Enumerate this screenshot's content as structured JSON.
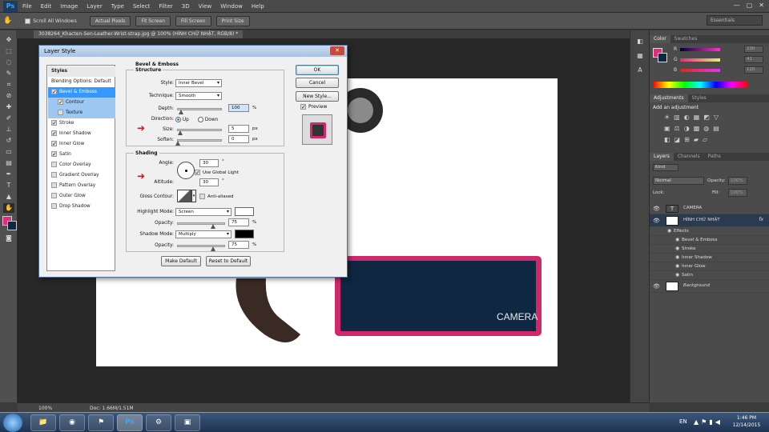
{
  "app": {
    "logo": "Ps",
    "menu": [
      "File",
      "Edit",
      "Image",
      "Layer",
      "Type",
      "Select",
      "Filter",
      "3D",
      "View",
      "Window",
      "Help"
    ],
    "window_controls": [
      "—",
      "▢",
      "✕"
    ]
  },
  "options_bar": {
    "scroll_all_windows": "Scroll All Windows",
    "buttons": [
      "Actual Pixels",
      "Fit Screen",
      "Fill Screen",
      "Print Size"
    ],
    "workspace": "Essentials"
  },
  "document": {
    "tab_title": "3038264_Khacten-Sen-Leather-Wrist-strap.jpg @ 100% (HÌNH CHỮ NHẬT, RGB/8) *",
    "canvas_text": "CAMERA",
    "zoom": "100%",
    "doc_size": "Doc: 1.66M/1.51M"
  },
  "dialog": {
    "title": "Layer Style",
    "close": "✕",
    "styles_header": "Styles",
    "blending_options": "Blending Options: Default",
    "style_items": [
      {
        "label": "Bevel & Emboss",
        "checked": true,
        "state": "selected"
      },
      {
        "label": "Contour",
        "checked": true,
        "state": "sub"
      },
      {
        "label": "Texture",
        "checked": false,
        "state": "sub"
      },
      {
        "label": "Stroke",
        "checked": true,
        "state": ""
      },
      {
        "label": "Inner Shadow",
        "checked": true,
        "state": ""
      },
      {
        "label": "Inner Glow",
        "checked": true,
        "state": ""
      },
      {
        "label": "Satin",
        "checked": true,
        "state": ""
      },
      {
        "label": "Color Overlay",
        "checked": false,
        "state": ""
      },
      {
        "label": "Gradient Overlay",
        "checked": false,
        "state": ""
      },
      {
        "label": "Pattern Overlay",
        "checked": false,
        "state": ""
      },
      {
        "label": "Outer Glow",
        "checked": false,
        "state": ""
      },
      {
        "label": "Drop Shadow",
        "checked": false,
        "state": ""
      }
    ],
    "section_title": "Bevel & Emboss",
    "structure": {
      "title": "Structure",
      "style_label": "Style:",
      "style_value": "Inner Bevel",
      "technique_label": "Technique:",
      "technique_value": "Smooth",
      "depth_label": "Depth:",
      "depth_value": "100",
      "depth_unit": "%",
      "depth_level": 0.08,
      "direction_label": "Direction:",
      "direction_up": "Up",
      "direction_down": "Down",
      "size_label": "Size:",
      "size_value": "5",
      "size_unit": "px",
      "size_level": 0.05,
      "soften_label": "Soften:",
      "soften_value": "0",
      "soften_unit": "px",
      "soften_level": 0.0
    },
    "shading": {
      "title": "Shading",
      "angle_label": "Angle:",
      "angle_value": "30",
      "angle_unit": "°",
      "global_light": "Use Global Light",
      "altitude_label": "Altitude:",
      "altitude_value": "30",
      "altitude_unit": "°",
      "gloss_label": "Gloss Contour:",
      "anti_aliased": "Anti-aliased",
      "highlight_label": "Highlight Mode:",
      "highlight_value": "Screen",
      "highlight_color": "#ffffff",
      "h_opacity_label": "Opacity:",
      "h_opacity_value": "75",
      "h_opacity_unit": "%",
      "h_opacity_level": 0.75,
      "shadow_label": "Shadow Mode:",
      "shadow_value": "Multiply",
      "shadow_color": "#000000",
      "s_opacity_label": "Opacity:",
      "s_opacity_value": "75",
      "s_opacity_unit": "%",
      "s_opacity_level": 0.75
    },
    "make_default": "Make Default",
    "reset_default": "Reset to Default",
    "ok": "OK",
    "cancel": "Cancel",
    "new_style": "New Style...",
    "preview": "Preview"
  },
  "panels": {
    "color_tabs": [
      "Color",
      "Swatches"
    ],
    "rgb": [
      {
        "label": "R",
        "value": "230"
      },
      {
        "label": "G",
        "value": "41"
      },
      {
        "label": "B",
        "value": "120"
      }
    ],
    "foreground_color": "#e6297a",
    "adjustments_tabs": [
      "Adjustments",
      "Styles"
    ],
    "add_adjustment": "Add an adjustment",
    "layers_tabs": [
      "Layers",
      "Channels",
      "Paths"
    ],
    "kind": "Kind",
    "blend_mode": "Normal",
    "opacity_label": "Opacity:",
    "opacity_value": "100%",
    "lock_label": "Lock:",
    "fill_label": "Fill:",
    "fill_value": "100%",
    "layers": [
      {
        "name": "CAMERA",
        "kind": "text"
      },
      {
        "name": "HÌNH CHỮ NHẬT",
        "kind": "shape",
        "selected": true
      },
      {
        "name": "Effects",
        "kind": "effect-group"
      },
      {
        "name": "Bevel & Emboss",
        "kind": "effect"
      },
      {
        "name": "Stroke",
        "kind": "effect"
      },
      {
        "name": "Inner Shadow",
        "kind": "effect"
      },
      {
        "name": "Inner Glow",
        "kind": "effect"
      },
      {
        "name": "Satin",
        "kind": "effect"
      },
      {
        "name": "Background",
        "kind": "image"
      }
    ]
  },
  "taskbar": {
    "apps": [
      "📁",
      "◉",
      "⚑",
      "Ps",
      "⚙",
      "▣"
    ],
    "lang": "EN",
    "time": "1:46 PM",
    "date": "12/14/2015"
  },
  "colors": {
    "accent_pink": "#d0286c",
    "navy": "#0f2740",
    "selection_blue": "#3399ff"
  }
}
